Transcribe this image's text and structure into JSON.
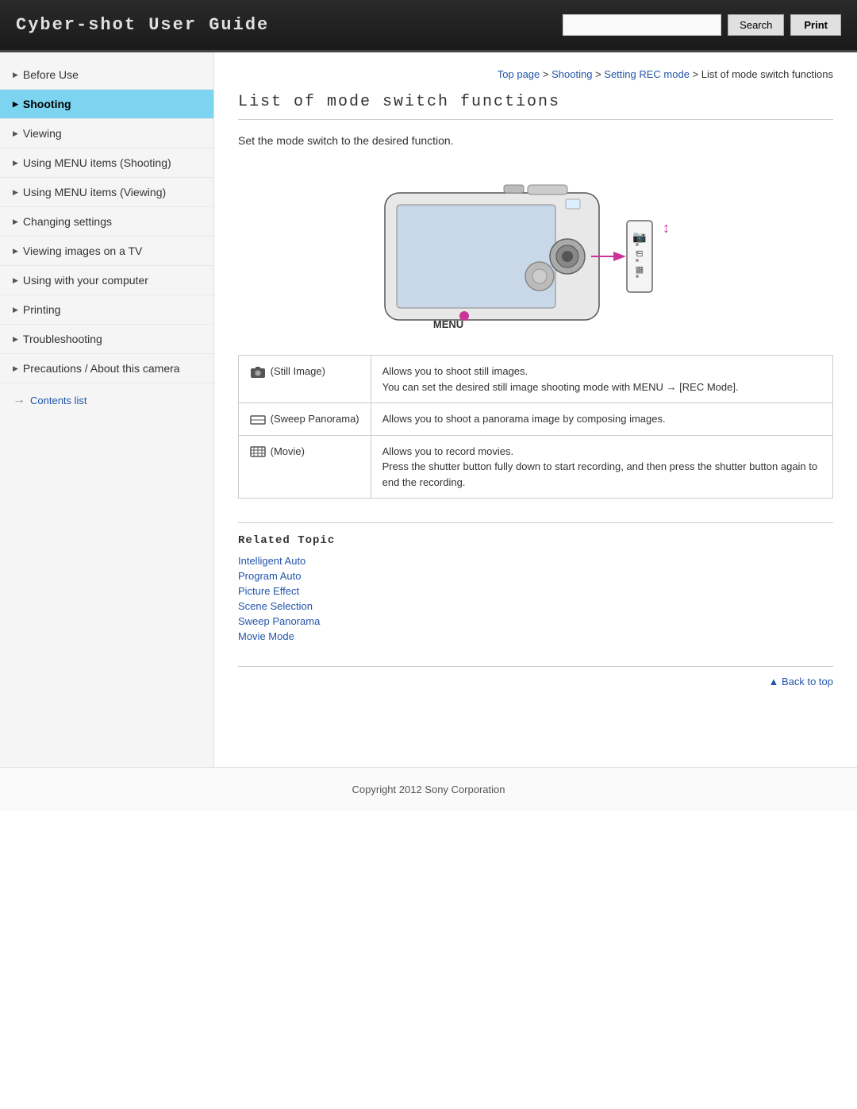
{
  "header": {
    "title": "Cyber-shot User Guide",
    "search_placeholder": "",
    "search_label": "Search",
    "print_label": "Print"
  },
  "breadcrumb": {
    "top": "Top page",
    "shooting": "Shooting",
    "setting_rec": "Setting REC mode",
    "current": "List of mode switch functions"
  },
  "page": {
    "title": "List of mode switch functions",
    "intro": "Set the mode switch to the desired function."
  },
  "sidebar": {
    "items": [
      {
        "label": "Before Use",
        "active": false
      },
      {
        "label": "Shooting",
        "active": true
      },
      {
        "label": "Viewing",
        "active": false
      },
      {
        "label": "Using MENU items (Shooting)",
        "active": false
      },
      {
        "label": "Using MENU items (Viewing)",
        "active": false
      },
      {
        "label": "Changing settings",
        "active": false
      },
      {
        "label": "Viewing images on a TV",
        "active": false
      },
      {
        "label": "Using with your computer",
        "active": false
      },
      {
        "label": "Printing",
        "active": false
      },
      {
        "label": "Troubleshooting",
        "active": false
      },
      {
        "label": "Precautions / About this camera",
        "active": false
      }
    ],
    "contents_link": "Contents list"
  },
  "modes": [
    {
      "icon_label": "(Still Image)",
      "description_1": "Allows you to shoot still images.",
      "description_2": "You can set the desired still image shooting mode with MENU → [REC Mode]."
    },
    {
      "icon_label": "(Sweep Panorama)",
      "description_1": "Allows you to shoot a panorama image by composing images.",
      "description_2": ""
    },
    {
      "icon_label": "(Movie)",
      "description_1": "Allows you to record movies.",
      "description_2": "Press the shutter button fully down to start recording, and then press the shutter button again to end the recording."
    }
  ],
  "related_topic": {
    "title": "Related Topic",
    "links": [
      "Intelligent Auto",
      "Program Auto",
      "Picture Effect",
      "Scene Selection",
      "Sweep Panorama",
      "Movie Mode"
    ]
  },
  "back_to_top": "▲ Back to top",
  "footer": "Copyright 2012 Sony Corporation"
}
